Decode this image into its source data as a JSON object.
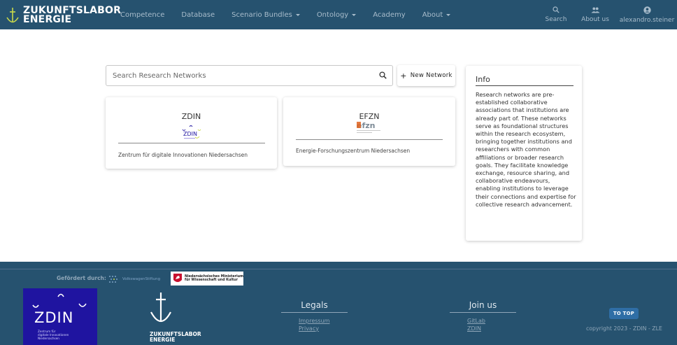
{
  "nav": {
    "brand_line1": "ZUKUNFTSLABOR",
    "brand_line2": "ENERGIE",
    "links": [
      {
        "label": "Competence",
        "dropdown": false
      },
      {
        "label": "Database",
        "dropdown": false
      },
      {
        "label": "Scenario Bundles",
        "dropdown": true
      },
      {
        "label": "Ontology",
        "dropdown": true
      },
      {
        "label": "Academy",
        "dropdown": false
      },
      {
        "label": "About",
        "dropdown": true
      }
    ],
    "search_label": "Search",
    "about_us_label": "About us",
    "username": "alexandro.steiner"
  },
  "main": {
    "search_placeholder": "Search Research Networks",
    "new_network_label": "New Network",
    "cards": [
      {
        "title": "ZDIN",
        "description": "Zentrum für digitale Innovationen Niedersachsen",
        "logo_text": "ZDIN"
      },
      {
        "title": "EFZN",
        "description": "Energie-Forschungszentrum Niedersachsen",
        "logo_text": "efzn"
      }
    ]
  },
  "info": {
    "title": "Info",
    "text": "Research networks are pre-established collaborative associations that institutions are already part of. These networks serve as foundational structures within the research ecosystem, bringing together institutions and researchers with common affiliations or broader research goals. They facilitate knowledge exchange, resource sharing, and collaborative endeavours, enabling institutions to leverage their connections and expertise for collective research advancement."
  },
  "footer": {
    "funded_by": "Gefördert durch:",
    "vw_text": "VolkswagenStiftung",
    "ministry_line1": "Niedersächsisches Ministerium",
    "ministry_line2": "für Wissenschaft und Kultur",
    "zdin_word": "ZDIN",
    "zdin_sub1": "Zentrum für",
    "zdin_sub2": "digitale Innovationen",
    "zdin_sub3": "Niedersachsen",
    "zle_line1": "ZUKUNFTSLABOR",
    "zle_line2": "ENERGIE",
    "legals_title": "Legals",
    "legals_links": [
      "Impressum",
      "Privacy"
    ],
    "join_title": "Join us",
    "join_links": [
      "GitLab",
      "ZDIN"
    ],
    "to_top_label": "TO TOP",
    "copyright": "copyright 2023 - ZDIN - ZLE"
  },
  "colors": {
    "navbar_bg": "#26526f",
    "footer_bg": "#26526f",
    "zdin_blue": "#1f14a0",
    "to_top_button": "#2f6ea6"
  }
}
